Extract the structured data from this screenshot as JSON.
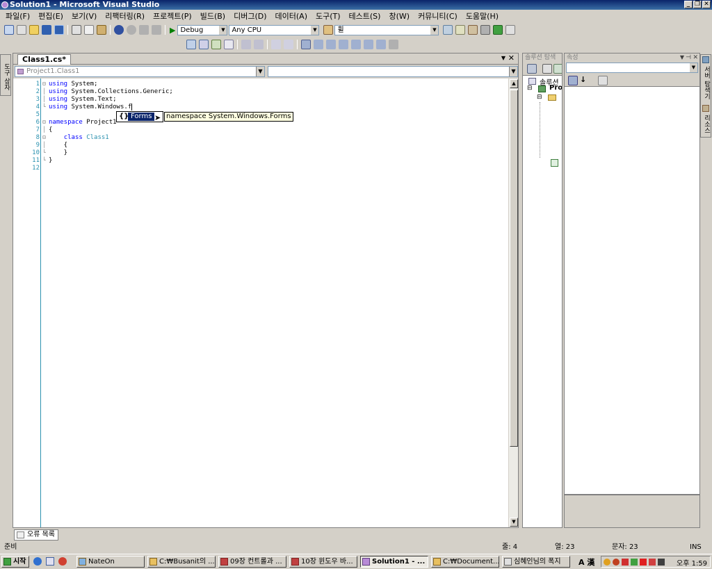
{
  "window": {
    "title": "Solution1 - Microsoft Visual Studio"
  },
  "menu": [
    "파일(F)",
    "편집(E)",
    "보기(V)",
    "리팩터링(R)",
    "프로젝트(P)",
    "빌드(B)",
    "디버그(D)",
    "데이터(A)",
    "도구(T)",
    "테스트(S)",
    "창(W)",
    "커뮤니티(C)",
    "도움말(H)"
  ],
  "toolbar": {
    "config": "Debug",
    "platform": "Any CPU",
    "find": "휠"
  },
  "editor": {
    "tab": "Class1.cs*",
    "nav_left": "Project1.Class1",
    "nav_right": "",
    "lines": [
      {
        "n": "1",
        "fold": "⊟",
        "tokens": [
          {
            "k": "kw",
            "t": "using"
          },
          {
            "k": "",
            "t": " System;"
          }
        ]
      },
      {
        "n": "2",
        "fold": "│",
        "tokens": [
          {
            "k": "kw",
            "t": "using"
          },
          {
            "k": "",
            "t": " System.Collections.Generic;"
          }
        ]
      },
      {
        "n": "3",
        "fold": "│",
        "tokens": [
          {
            "k": "kw",
            "t": "using"
          },
          {
            "k": "",
            "t": " System.Text;"
          }
        ]
      },
      {
        "n": "4",
        "fold": "└",
        "tokens": [
          {
            "k": "kw",
            "t": "using"
          },
          {
            "k": "",
            "t": " System.Windows.f"
          }
        ]
      },
      {
        "n": "5",
        "fold": "",
        "tokens": []
      },
      {
        "n": "6",
        "fold": "⊟",
        "tokens": [
          {
            "k": "kw",
            "t": "namespace"
          },
          {
            "k": "",
            "t": " Project1"
          }
        ]
      },
      {
        "n": "7",
        "fold": "│",
        "tokens": [
          {
            "k": "",
            "t": "{"
          }
        ]
      },
      {
        "n": "8",
        "fold": "⊟",
        "tokens": [
          {
            "k": "",
            "t": "    "
          },
          {
            "k": "kw",
            "t": "class"
          },
          {
            "k": "",
            "t": " "
          },
          {
            "k": "ty",
            "t": "Class1"
          }
        ]
      },
      {
        "n": "9",
        "fold": "│",
        "tokens": [
          {
            "k": "",
            "t": "    {"
          }
        ]
      },
      {
        "n": "10",
        "fold": "└",
        "tokens": [
          {
            "k": "",
            "t": "    }"
          }
        ]
      },
      {
        "n": "11",
        "fold": "└",
        "tokens": [
          {
            "k": "",
            "t": "}"
          }
        ]
      },
      {
        "n": "12",
        "fold": "",
        "tokens": []
      }
    ]
  },
  "intellisense": {
    "selected": "Forms",
    "tooltip": "namespace System.Windows.Forms"
  },
  "solution_explorer": {
    "title": "솔루션 탐색",
    "root": "솔루션",
    "project": "Pro"
  },
  "properties": {
    "title": "속성"
  },
  "left_strip": "도구 상자",
  "right_strip_1": "서버 탐색기",
  "right_strip_2": "리소스",
  "error_tab": "오류 목록",
  "status": {
    "ready": "준비",
    "line": "줄: 4",
    "col": "열: 23",
    "ch": "문자: 23",
    "mode": "INS"
  },
  "taskbar": {
    "start": "시작",
    "tasks": [
      "NateOn",
      "C:₩Busanit의 ...",
      "09장 컨트롤과 ...",
      "10장 윈도우 바...",
      "Solution1 - ...",
      "C:₩Document...",
      "심혜인님의 폭지"
    ],
    "clock": "오후 1:59",
    "ime": "A 漢"
  }
}
